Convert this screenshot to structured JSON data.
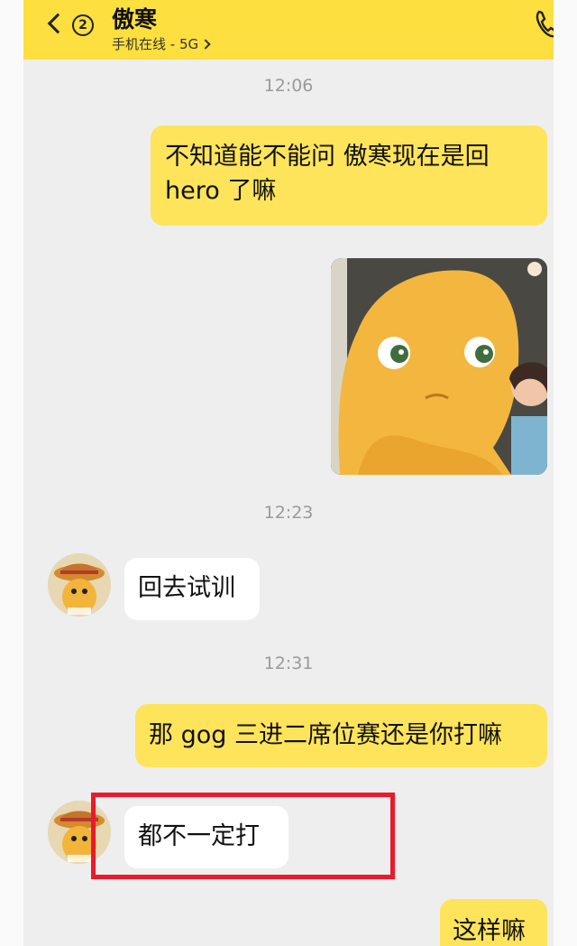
{
  "header": {
    "contact_name": "傲寒",
    "status": "手机在线 - 5G",
    "unread_count": "2"
  },
  "messages": [
    {
      "type": "time",
      "text": "12:06"
    },
    {
      "type": "outgoing_text",
      "text_line1": "不知道能不能问 傲寒现在是回",
      "text_line2": "hero 了嘛"
    },
    {
      "type": "outgoing_sticker"
    },
    {
      "type": "time",
      "text": "12:23"
    },
    {
      "type": "incoming_text",
      "text": "回去试训"
    },
    {
      "type": "time",
      "text": "12:31"
    },
    {
      "type": "outgoing_text",
      "text": "那 gog 三进二席位赛还是你打嘛"
    },
    {
      "type": "incoming_text",
      "text": "都不一定打"
    },
    {
      "type": "outgoing_text",
      "text": "这样嘛"
    }
  ],
  "colors": {
    "header_bg": "#fddf3f",
    "outgoing_bubble": "#fde45a",
    "incoming_bubble": "#ffffff",
    "highlight": "#ea1a2c"
  }
}
